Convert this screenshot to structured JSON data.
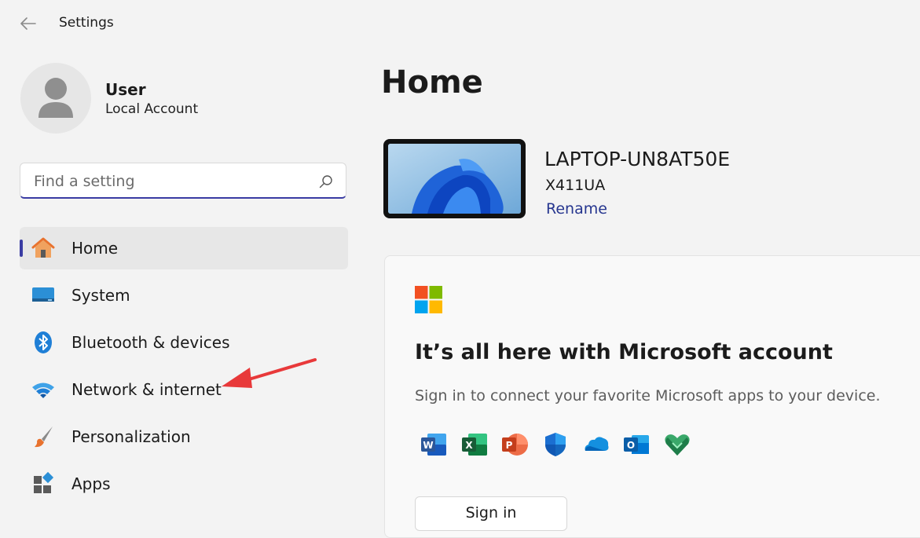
{
  "window": {
    "title": "Settings"
  },
  "user": {
    "name": "User",
    "account_type": "Local Account"
  },
  "search": {
    "placeholder": "Find a setting"
  },
  "nav": {
    "items": [
      {
        "label": "Home",
        "icon": "home-icon",
        "selected": true
      },
      {
        "label": "System",
        "icon": "system-icon"
      },
      {
        "label": "Bluetooth & devices",
        "icon": "bluetooth-icon"
      },
      {
        "label": "Network & internet",
        "icon": "wifi-icon"
      },
      {
        "label": "Personalization",
        "icon": "paintbrush-icon"
      },
      {
        "label": "Apps",
        "icon": "apps-icon"
      }
    ]
  },
  "main": {
    "title": "Home",
    "device": {
      "name": "LAPTOP-UN8AT50E",
      "model": "X411UA",
      "rename_label": "Rename"
    },
    "account_card": {
      "title": "It’s all here with Microsoft account",
      "description": "Sign in to connect your favorite Microsoft apps to your device.",
      "apps": [
        "word-icon",
        "excel-icon",
        "powerpoint-icon",
        "defender-icon",
        "onedrive-icon",
        "outlook-icon",
        "family-safety-icon"
      ],
      "sign_in_label": "Sign in"
    }
  },
  "colors": {
    "accent": "#3a3ca3",
    "link": "#26368f",
    "annotation_arrow": "#e8393a"
  }
}
